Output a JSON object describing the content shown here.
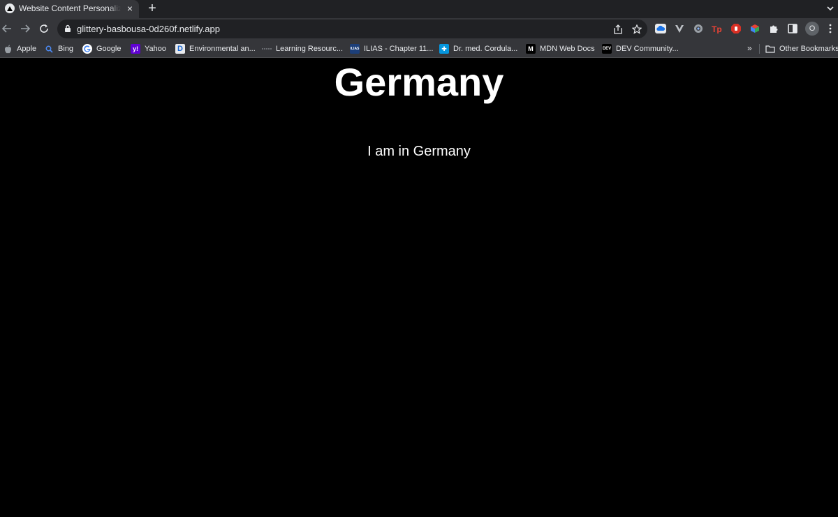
{
  "browser": {
    "tab": {
      "title": "Website Content Personalization",
      "close_glyph": "×"
    },
    "new_tab_glyph": "+",
    "url": "glittery-basbousa-0d260f.netlify.app",
    "profile_initial": "O",
    "icons": {
      "back": "arrow-left-icon",
      "forward": "arrow-right-icon",
      "reload": "reload-icon",
      "lock": "lock-icon",
      "share": "share-icon",
      "bookmark": "star-icon",
      "extensions": "puzzle-icon",
      "sidepanel": "side-panel-icon",
      "menu": "three-dots-icon",
      "tab_search": "chevron-down-icon"
    },
    "colors": {
      "tabstrip": "#202124",
      "toolbar": "#35363a",
      "omnibox": "#202124",
      "text": "#e8eaed"
    }
  },
  "bookmarks": {
    "items": [
      {
        "label": "Apple",
        "icon": "apple-icon"
      },
      {
        "label": "Bing",
        "icon": "bing-search-icon"
      },
      {
        "label": "Google",
        "icon": "google-icon"
      },
      {
        "label": "Yahoo",
        "icon": "yahoo-icon"
      },
      {
        "label": "Environmental an...",
        "icon": "d-letter-icon"
      },
      {
        "label": "Learning Resourc...",
        "icon": "dash-icon"
      },
      {
        "label": "ILIAS - Chapter 11...",
        "icon": "ilias-icon"
      },
      {
        "label": "Dr. med. Cordula...",
        "icon": "doctolib-icon"
      },
      {
        "label": "MDN Web Docs",
        "icon": "mdn-icon"
      },
      {
        "label": "DEV Community...",
        "icon": "dev-icon"
      }
    ],
    "more_glyph": "»",
    "other_label": "Other Bookmarks",
    "other_icon": "folder-icon"
  },
  "page": {
    "heading": "Germany",
    "text": "I am in Germany",
    "background": "#000000",
    "foreground": "#ffffff"
  }
}
